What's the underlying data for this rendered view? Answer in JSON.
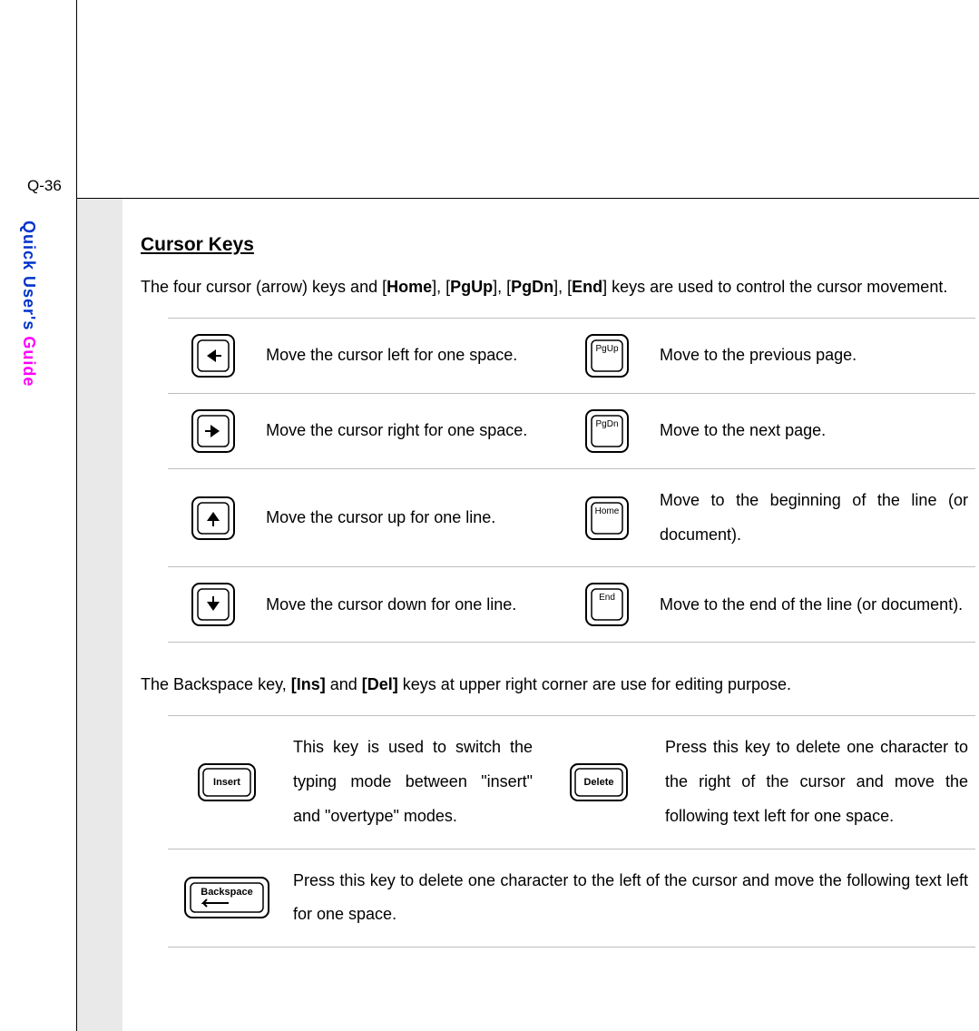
{
  "page_number": "Q-36",
  "side_label_primary": "Quick User's ",
  "side_label_secondary": "Guide",
  "section_title": "Cursor Keys",
  "intro_parts": {
    "p1": "The four cursor (arrow) keys and [",
    "home": "Home",
    "p2": "], [",
    "pgup": "PgUp",
    "p3": "], [",
    "pgdn": "PgDn",
    "p4": "], [",
    "end": "End",
    "p5": "] keys are used to control the cursor movement."
  },
  "cursor_rows": [
    {
      "left_key": "arrow-left",
      "left_desc": "Move the cursor left for one space.",
      "right_key": "PgUp",
      "right_desc": "Move to the previous page."
    },
    {
      "left_key": "arrow-right",
      "left_desc": "Move the cursor right for one space.",
      "right_key": "PgDn",
      "right_desc": "Move to the next page."
    },
    {
      "left_key": "arrow-up",
      "left_desc": "Move the cursor up for one line.",
      "right_key": "Home",
      "right_desc": "Move to the beginning of the line (or document)."
    },
    {
      "left_key": "arrow-down",
      "left_desc": "Move the cursor down for one line.",
      "right_key": "End",
      "right_desc": "Move to the end of the line (or document)."
    }
  ],
  "mid_text_parts": {
    "p1": "The Backspace key, ",
    "ins": "[Ins]",
    "p2": " and ",
    "del": "[Del]",
    "p3": " keys at upper right corner are use for editing purpose."
  },
  "edit_rows": {
    "insert_desc": "This key is used to switch the typing mode between \"insert\" and \"overtype\" modes.",
    "delete_desc": "Press this key to delete one character to the right of the cursor and move the following text left for one space.",
    "backspace_desc": "Press this key to delete one character to the left of the cursor and move the following text left for one space."
  },
  "key_labels": {
    "insert": "Insert",
    "delete": "Delete",
    "backspace": "Backspace",
    "pgup": "PgUp",
    "pgdn": "PgDn",
    "home": "Home",
    "end": "End"
  }
}
